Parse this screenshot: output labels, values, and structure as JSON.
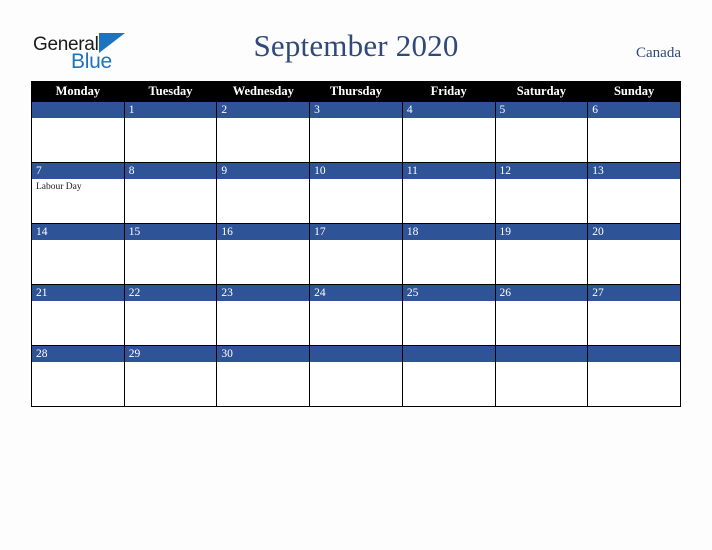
{
  "brand": {
    "word1": "General",
    "word2": "Blue",
    "triangle_color": "#1e73be",
    "word1_color": "#1b1b1b",
    "word2_color": "#1e73be"
  },
  "header": {
    "title": "September 2020",
    "country": "Canada",
    "title_color": "#2f4979"
  },
  "calendar": {
    "header_bg": "#000000",
    "header_fg": "#ffffff",
    "daybar_bg": "#2e5396",
    "daybar_fg": "#ffffff",
    "cell_bg": "#ffffff",
    "weekdays": [
      "Monday",
      "Tuesday",
      "Wednesday",
      "Thursday",
      "Friday",
      "Saturday",
      "Sunday"
    ],
    "weeks": [
      [
        {
          "date": "",
          "event": ""
        },
        {
          "date": "1",
          "event": ""
        },
        {
          "date": "2",
          "event": ""
        },
        {
          "date": "3",
          "event": ""
        },
        {
          "date": "4",
          "event": ""
        },
        {
          "date": "5",
          "event": ""
        },
        {
          "date": "6",
          "event": ""
        }
      ],
      [
        {
          "date": "7",
          "event": "Labour Day"
        },
        {
          "date": "8",
          "event": ""
        },
        {
          "date": "9",
          "event": ""
        },
        {
          "date": "10",
          "event": ""
        },
        {
          "date": "11",
          "event": ""
        },
        {
          "date": "12",
          "event": ""
        },
        {
          "date": "13",
          "event": ""
        }
      ],
      [
        {
          "date": "14",
          "event": ""
        },
        {
          "date": "15",
          "event": ""
        },
        {
          "date": "16",
          "event": ""
        },
        {
          "date": "17",
          "event": ""
        },
        {
          "date": "18",
          "event": ""
        },
        {
          "date": "19",
          "event": ""
        },
        {
          "date": "20",
          "event": ""
        }
      ],
      [
        {
          "date": "21",
          "event": ""
        },
        {
          "date": "22",
          "event": ""
        },
        {
          "date": "23",
          "event": ""
        },
        {
          "date": "24",
          "event": ""
        },
        {
          "date": "25",
          "event": ""
        },
        {
          "date": "26",
          "event": ""
        },
        {
          "date": "27",
          "event": ""
        }
      ],
      [
        {
          "date": "28",
          "event": ""
        },
        {
          "date": "29",
          "event": ""
        },
        {
          "date": "30",
          "event": ""
        },
        {
          "date": "",
          "event": ""
        },
        {
          "date": "",
          "event": ""
        },
        {
          "date": "",
          "event": ""
        },
        {
          "date": "",
          "event": ""
        }
      ]
    ]
  }
}
